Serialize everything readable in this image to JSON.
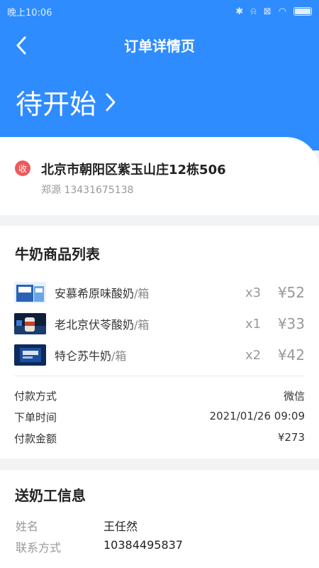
{
  "status_bar": {
    "time": "晚上10:06"
  },
  "header": {
    "title": "订单详情页",
    "order_status": "待开始"
  },
  "address": {
    "badge": "收",
    "address": "北京市朝阳区紫玉山庄12栋506",
    "contact": "郑源 13431675138"
  },
  "products": {
    "title": "牛奶商品列表",
    "items": [
      {
        "name": "安慕希原味酸奶",
        "unit": "/箱",
        "qty": "x3",
        "price": "¥52"
      },
      {
        "name": "老北京伏苓酸奶",
        "unit": "/箱",
        "qty": "x1",
        "price": "¥33"
      },
      {
        "name": "特仑苏牛奶",
        "unit": "/箱",
        "qty": "x2",
        "price": "¥42"
      }
    ],
    "payment_method_label": "付款方式",
    "payment_method": "微信",
    "order_time_label": "下单时间",
    "order_time": "2021/01/26 09:09",
    "amount_label": "付款金额",
    "amount": "¥273"
  },
  "worker": {
    "title": "送奶工信息",
    "name_label": "姓名",
    "name": "王任然",
    "phone_label": "联系方式",
    "phone": "10384495837"
  },
  "colors": {
    "primary": "#2f8cff",
    "badge": "#ee5a5a",
    "muted": "#999999"
  }
}
